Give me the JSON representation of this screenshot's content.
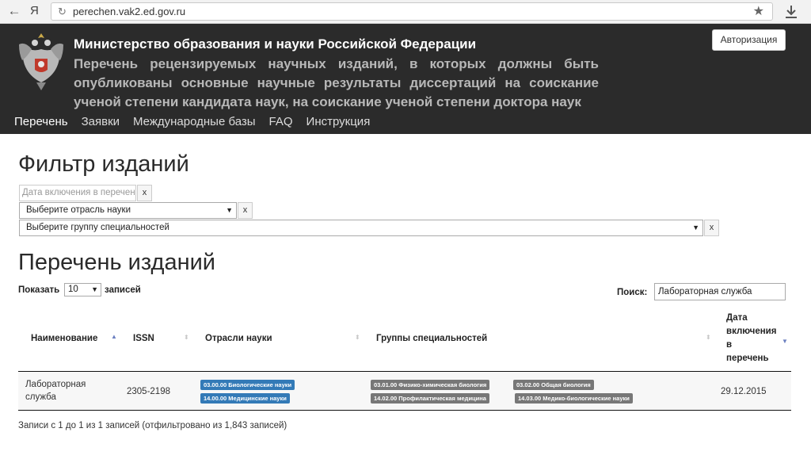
{
  "browser": {
    "back_icon": "←",
    "ya_label": "Я",
    "reload_icon": "↻",
    "url": "perechen.vak2.ed.gov.ru",
    "star_icon": "★"
  },
  "header": {
    "title": "Министерство образования и науки Российской Федерации",
    "subtitle": "Перечень рецензируемых научных изданий, в которых должны быть опубликованы основные научные результаты диссертаций на соискание ученой степени кандидата наук, на соискание ученой степени доктора наук",
    "auth_button": "Авторизация",
    "nav": [
      {
        "label": "Перечень"
      },
      {
        "label": "Заявки"
      },
      {
        "label": "Международные базы"
      },
      {
        "label": "FAQ"
      },
      {
        "label": "Инструкция"
      }
    ]
  },
  "filter": {
    "title": "Фильтр изданий",
    "date_placeholder": "Дата включения в перечень",
    "clear_label": "x",
    "science_select": "Выберите отрасль науки",
    "group_select": "Выберите группу специальностей",
    "select_arrow": "▼"
  },
  "list": {
    "title": "Перечень изданий",
    "show_label": "Показать",
    "length_value": "10",
    "entries_label": "записей",
    "search_label": "Поиск:",
    "search_value": "Лабораторная служба",
    "columns": {
      "name": "Наименование",
      "issn": "ISSN",
      "branches": "Отрасли науки",
      "groups": "Группы специальностей",
      "date_lines": [
        "Дата",
        "включения",
        "в",
        "перечень"
      ]
    },
    "sort_icons": {
      "asc": "▲",
      "desc": "▼",
      "both": "⬍"
    },
    "rows": [
      {
        "name_lines": [
          "Лабораторная",
          "служба"
        ],
        "issn": "2305-2198",
        "branches": [
          "03.00.00 Биологические науки",
          "14.00.00 Медицинские науки"
        ],
        "groups": [
          "03.01.00 Физико-химическая биология",
          "03.02.00 Общая биология",
          "14.02.00 Профилактическая медицина",
          "14.03.00 Медико-биологические науки"
        ],
        "date": "29.12.2015"
      }
    ],
    "info": "Записи с 1 до 1 из 1 записей (отфильтровано из 1,843 записей)"
  },
  "colors": {
    "header_bg": "#2b2b2b",
    "badge_blue": "#337ab7",
    "badge_gray": "#777777",
    "sort_active": "#6b7fc0"
  }
}
